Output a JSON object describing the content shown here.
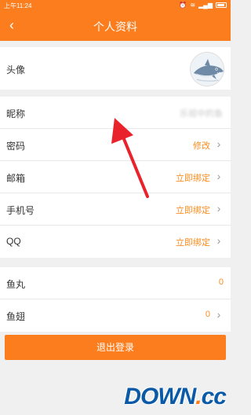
{
  "status_bar": {
    "time": "上午11:24",
    "icons": [
      "alarm-icon",
      "wifi-icon",
      "signal-icon",
      "battery-icon"
    ]
  },
  "header": {
    "title": "个人资料",
    "back_icon": "back-arrow-icon"
  },
  "profile": {
    "avatar_label": "头像",
    "rows": [
      {
        "label": "昵称",
        "value": "乐视中的鱼",
        "action": false
      },
      {
        "label": "密码",
        "value": "修改",
        "action": true
      },
      {
        "label": "邮箱",
        "value": "立即绑定",
        "action": true
      },
      {
        "label": "手机号",
        "value": "立即绑定",
        "action": true
      },
      {
        "label": "QQ",
        "value": "立即绑定",
        "action": true
      }
    ]
  },
  "assets": {
    "rows": [
      {
        "label": "鱼丸",
        "value": "0"
      },
      {
        "label": "鱼翅",
        "value": "0"
      }
    ]
  },
  "logout_label": "退出登录",
  "watermark": {
    "main": "DOWN",
    "dot": ".",
    "tail": "cc"
  },
  "colors": {
    "brand": "#fb7d1e",
    "accent_text": "#fb8c1e",
    "annotation_arrow": "#e8232b"
  }
}
